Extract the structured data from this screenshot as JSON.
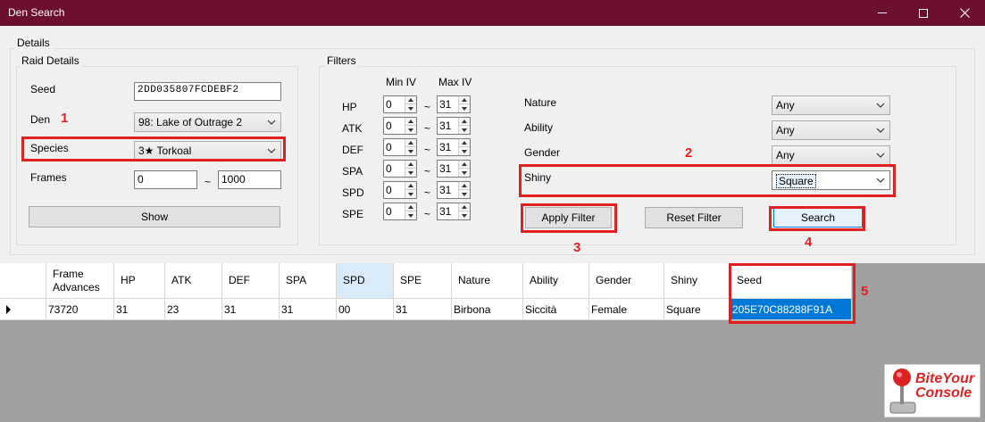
{
  "window": {
    "title": "Den Search"
  },
  "details": {
    "legend": "Details",
    "raid": {
      "legend": "Raid Details",
      "seed_label": "Seed",
      "seed_value": "2DD035807FCDEBF2",
      "den_label": "Den",
      "den_value": "98: Lake of Outrage 2",
      "species_label": "Species",
      "species_value": "3★ Torkoal",
      "frames_label": "Frames",
      "frames_from": "0",
      "frames_tilde": "~",
      "frames_to": "1000",
      "show_label": "Show"
    },
    "filters": {
      "legend": "Filters",
      "min_iv_label": "Min IV",
      "max_iv_label": "Max IV",
      "tilde": "~",
      "ivs": [
        {
          "stat": "HP",
          "min": "0",
          "max": "31"
        },
        {
          "stat": "ATK",
          "min": "0",
          "max": "31"
        },
        {
          "stat": "DEF",
          "min": "0",
          "max": "31"
        },
        {
          "stat": "SPA",
          "min": "0",
          "max": "31"
        },
        {
          "stat": "SPD",
          "min": "0",
          "max": "31"
        },
        {
          "stat": "SPE",
          "min": "0",
          "max": "31"
        }
      ],
      "nature_label": "Nature",
      "nature_value": "Any",
      "ability_label": "Ability",
      "ability_value": "Any",
      "gender_label": "Gender",
      "gender_value": "Any",
      "shiny_label": "Shiny",
      "shiny_value": "Square",
      "apply_label": "Apply Filter",
      "reset_label": "Reset Filter",
      "search_label": "Search"
    }
  },
  "annotations": [
    "1",
    "2",
    "3",
    "4",
    "5"
  ],
  "results": {
    "headers": [
      "Frame\nAdvances",
      "HP",
      "ATK",
      "DEF",
      "SPA",
      "SPD",
      "SPE",
      "Nature",
      "Ability",
      "Gender",
      "Shiny",
      "Seed"
    ],
    "rows": [
      [
        "73720",
        "31",
        "23",
        "31",
        "31",
        "00",
        "31",
        "Birbona",
        "Siccità",
        "Female",
        "Square",
        "205E70C88288F91A"
      ]
    ]
  },
  "watermark": {
    "text": "BiteYourConsole"
  },
  "colors": {
    "titlebar": "#6b0f2d",
    "annotation": "#e02020",
    "selection": "#0078d7"
  }
}
